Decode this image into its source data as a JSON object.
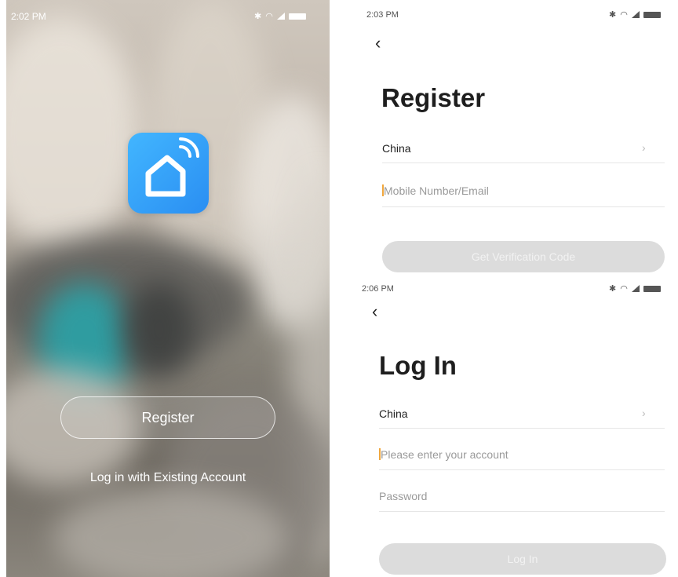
{
  "splash": {
    "time": "2:02 PM",
    "register_label": "Register",
    "existing_label": "Log in with Existing Account",
    "colors": {
      "icon_gradient_start": "#42b6ff",
      "icon_gradient_end": "#2a8ef2"
    }
  },
  "register_screen": {
    "time": "2:03 PM",
    "title": "Register",
    "country": "China",
    "account_placeholder": "Mobile Number/Email",
    "verify_button": "Get Verification Code"
  },
  "login_screen": {
    "time": "2:06 PM",
    "title": "Log In",
    "country": "China",
    "account_placeholder": "Please enter your account",
    "password_placeholder": "Password",
    "login_button": "Log In"
  },
  "icons": {
    "back": "back-arrow-icon",
    "chevron": "chevron-right-icon",
    "bluetooth": "bluetooth-icon",
    "wifi": "wifi-icon",
    "signal": "signal-icon",
    "battery": "battery-icon",
    "app": "smart-home-icon"
  }
}
